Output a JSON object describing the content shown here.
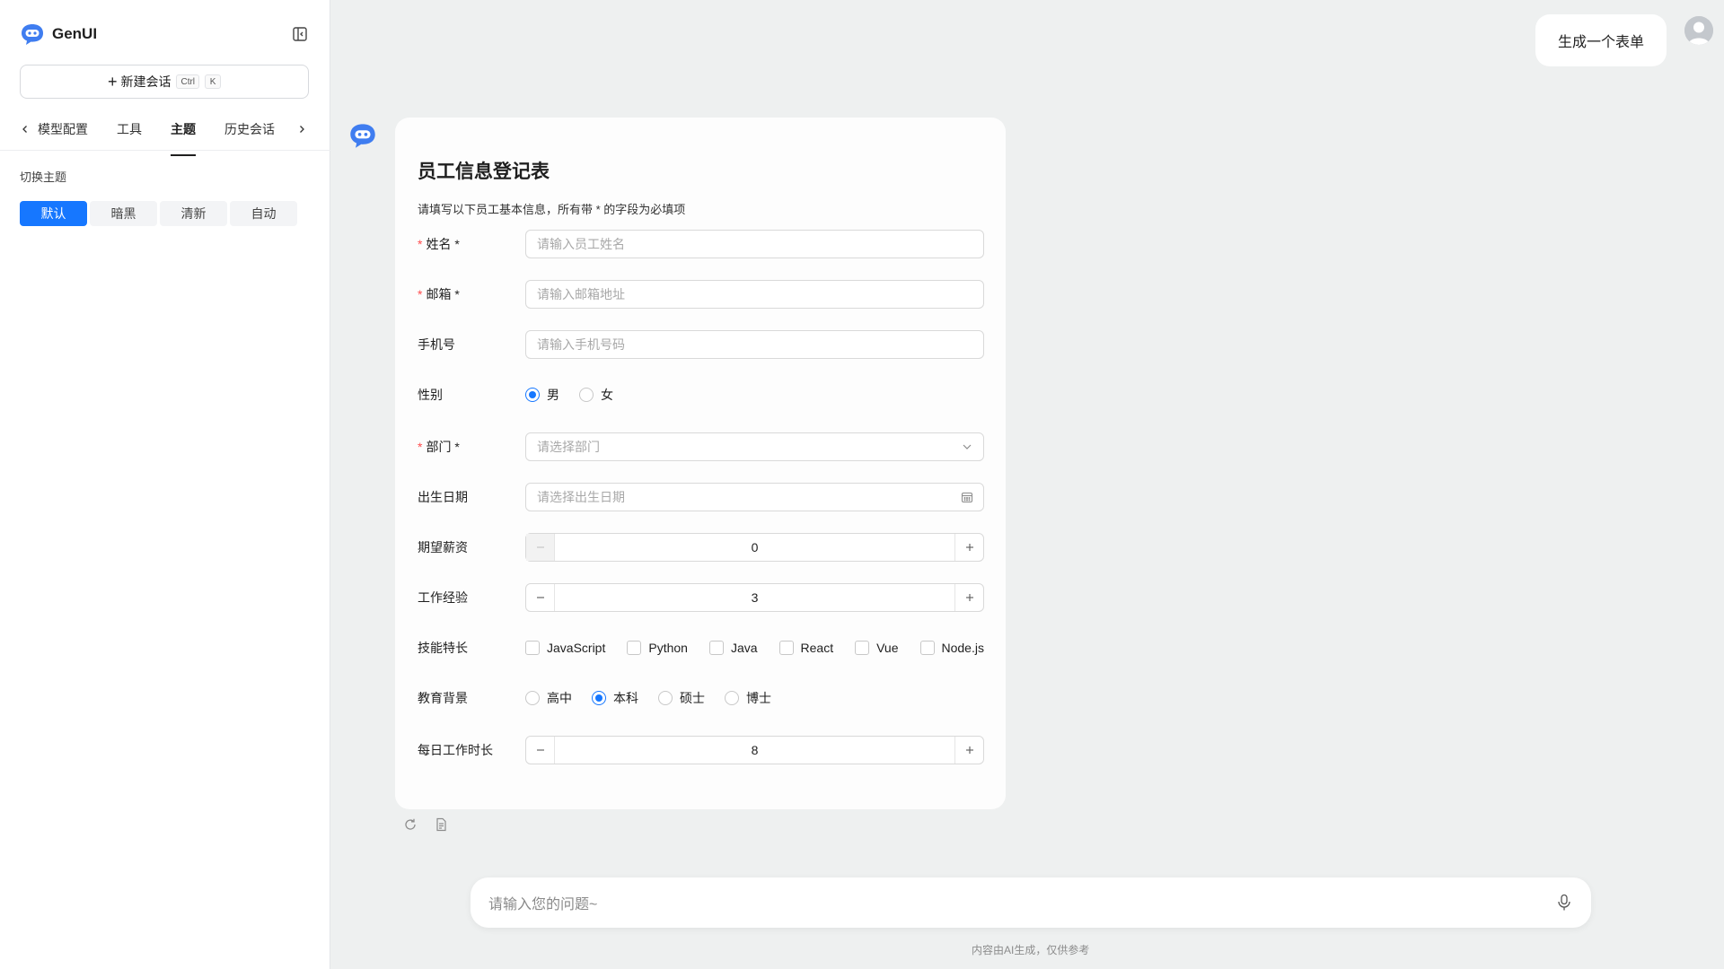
{
  "app": {
    "name": "GenUI"
  },
  "sidebar": {
    "new_chat": {
      "label": "新建会话",
      "kbd1": "Ctrl",
      "kbd2": "K"
    },
    "tabs": [
      {
        "label": "模型配置"
      },
      {
        "label": "工具"
      },
      {
        "label": "主题",
        "active": true
      },
      {
        "label": "历史会话"
      }
    ],
    "theme_label": "切换主题",
    "themes": [
      {
        "label": "默认",
        "active": true
      },
      {
        "label": "暗黑"
      },
      {
        "label": "清新"
      },
      {
        "label": "自动"
      }
    ]
  },
  "user_message": "生成一个表单",
  "form": {
    "title": "员工信息登记表",
    "description": "请填写以下员工基本信息，所有带 * 的字段为必填项",
    "required_mark": "*",
    "fields": {
      "name": {
        "label": "姓名 *",
        "placeholder": "请输入员工姓名"
      },
      "email": {
        "label": "邮箱 *",
        "placeholder": "请输入邮箱地址"
      },
      "phone": {
        "label": "手机号",
        "placeholder": "请输入手机号码"
      },
      "gender": {
        "label": "性别",
        "options": [
          "男",
          "女"
        ],
        "selected": "男"
      },
      "department": {
        "label": "部门 *",
        "placeholder": "请选择部门"
      },
      "birthday": {
        "label": "出生日期",
        "placeholder": "请选择出生日期"
      },
      "salary": {
        "label": "期望薪资",
        "value": "0"
      },
      "experience": {
        "label": "工作经验",
        "value": "3"
      },
      "skills": {
        "label": "技能特长",
        "options": [
          "JavaScript",
          "Python",
          "Java",
          "React",
          "Vue",
          "Node.js"
        ]
      },
      "education": {
        "label": "教育背景",
        "options": [
          "高中",
          "本科",
          "硕士",
          "博士"
        ],
        "selected": "本科"
      },
      "daily_hours": {
        "label": "每日工作时长",
        "value": "8"
      }
    }
  },
  "chat_input": {
    "placeholder": "请输入您的问题~"
  },
  "disclaimer": "内容由AI生成，仅供参考",
  "colors": {
    "accent": "#1677ff",
    "required": "#ff4d4f",
    "background": "#eef0f0"
  }
}
